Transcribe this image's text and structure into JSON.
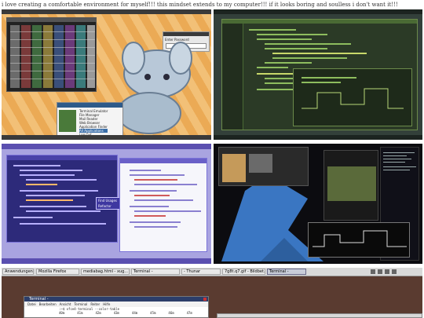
{
  "caption": "i love creating a comfortable environment for myself!!! this mindset extends to my computer!!! if it looks boring and soulless i don't want it!!!",
  "shot1": {
    "popup_title": "Enter Password",
    "menu_items": [
      "Terminal Emulator",
      "File Manager",
      "Mail Reader",
      "Web Browser",
      "Application Finder",
      "All Applications",
      "Log Out"
    ]
  },
  "shot3": {
    "popup_items": [
      "Find Usages",
      "Refactor"
    ]
  },
  "shot5": {
    "start": "Anwendungen",
    "tasks": [
      "Mozilla Firefox",
      "mediabag.html - xug...",
      "Terminal -",
      "- Thunar",
      "7g8t.q7.gif - Bildbet...",
      "Terminal -"
    ],
    "window_title": "Terminal -",
    "menu": [
      "Datei",
      "Bearbeiten",
      "Ansicht",
      "Terminal",
      "Reiter",
      "Hilfe"
    ],
    "command": ":~$ xfce4-terminal --color-table",
    "columns": [
      "40m",
      "41m",
      "42m",
      "43m",
      "44m",
      "45m",
      "46m",
      "47m"
    ]
  }
}
